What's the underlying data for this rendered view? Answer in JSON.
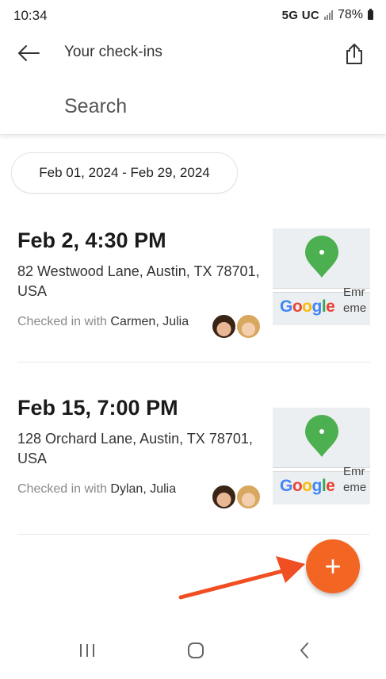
{
  "status_bar": {
    "time": "10:34",
    "network": "5G UC",
    "battery": "78%"
  },
  "header": {
    "title": "Your check-ins",
    "back_icon": "arrow-left-icon",
    "share_icon": "share-icon"
  },
  "search": {
    "placeholder": "Search"
  },
  "date_range": "Feb 01, 2024 - Feb 29, 2024",
  "checkins": [
    {
      "date": "Feb 2, 4:30 PM",
      "address": "82 Westwood Lane, Austin, TX 78701, USA",
      "with_prefix": "Checked in with",
      "with_names": "Carmen, Julia",
      "map_label_1": "Emr",
      "map_label_2": "eme"
    },
    {
      "date": "Feb 15, 7:00 PM",
      "address": "128 Orchard Lane, Austin, TX 78701, USA",
      "with_prefix": "Checked in with",
      "with_names": "Dylan, Julia",
      "map_label_1": "Emr",
      "map_label_2": "eme"
    }
  ],
  "map_brand": {
    "G": "G",
    "o1": "o",
    "o2": "o",
    "g": "g",
    "l": "l",
    "e": "e"
  },
  "fab": {
    "label": "+",
    "color": "#f26522"
  },
  "annotation_arrow_color": "#f04e23",
  "nav": {
    "recents_icon": "recents-icon",
    "home_icon": "home-icon",
    "back_icon": "nav-back-icon"
  }
}
